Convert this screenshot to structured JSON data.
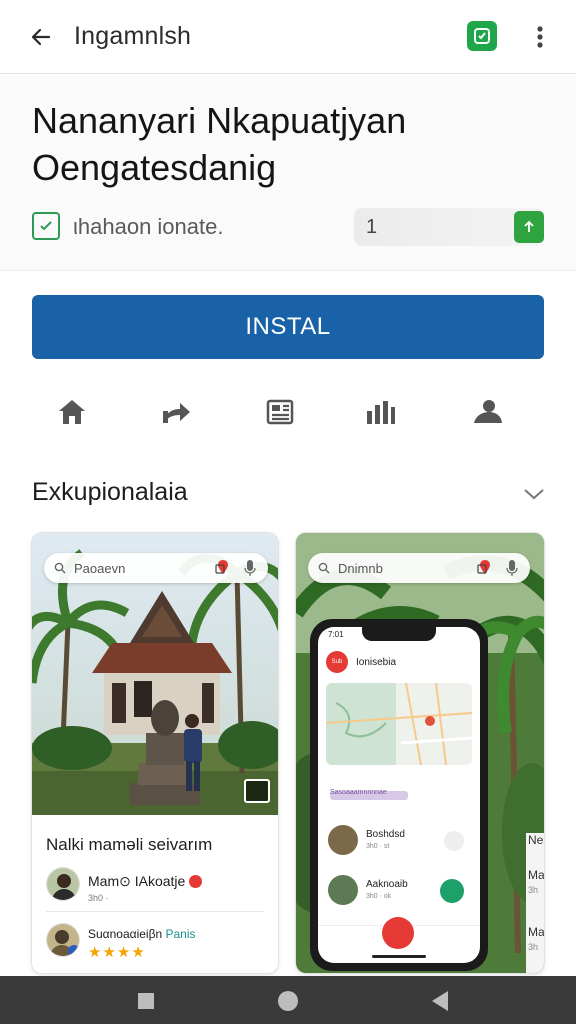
{
  "appbar": {
    "back_icon": "arrow-left-icon",
    "title": "Ingamnlsh",
    "badge_icon": "shield-check-icon",
    "badge_color": "#1fa64a",
    "more_icon": "more-vert-icon"
  },
  "app": {
    "name_line1": "Nananyari Nkapuatjyan",
    "name_line2": "Oengatesdanig",
    "developer_icon": "calendar-check-icon",
    "developer": "ιhahaon ionate.",
    "field_value": "1",
    "field_button_icon": "arrow-up-icon"
  },
  "install": {
    "label": "INSTAL",
    "color": "#1a62a8"
  },
  "actions": [
    {
      "icon": "home-icon"
    },
    {
      "icon": "share-icon"
    },
    {
      "icon": "news-icon"
    },
    {
      "icon": "bar-chart-icon"
    },
    {
      "icon": "person-icon"
    }
  ],
  "section": {
    "title": "Exkupionalaia",
    "chevron_icon": "chevron-down-icon"
  },
  "card1": {
    "search_text": "Paoaevn",
    "title": "Nalki maməli seivarım",
    "row1_name": "Mam⊙ IAkoatje",
    "row1_sub": "3h0 ·",
    "row2_text": "Suαnoaαieiβn",
    "row2_teal": "Panis",
    "stars": "★★★★"
  },
  "card2": {
    "search_text": "Dnimnb",
    "phone_status": "7:01",
    "phone_app_icon": "Sub",
    "phone_title": "Ionisebia",
    "pill_label": "Sasoaaamnnnnae",
    "row1_name": "Boshdsd",
    "row1_sub": "3h0 · st",
    "row2_name": "Aaknoaib",
    "row2_sub": "3h0 · ok",
    "right_label1": "Ne",
    "right_label2": "Ma",
    "right_sub2": "3h",
    "right_label3": "Ma",
    "right_sub3": "3h"
  },
  "sysnav": {
    "recent_icon": "square-icon",
    "home_icon": "circle-icon",
    "back_icon": "triangle-back-icon"
  }
}
